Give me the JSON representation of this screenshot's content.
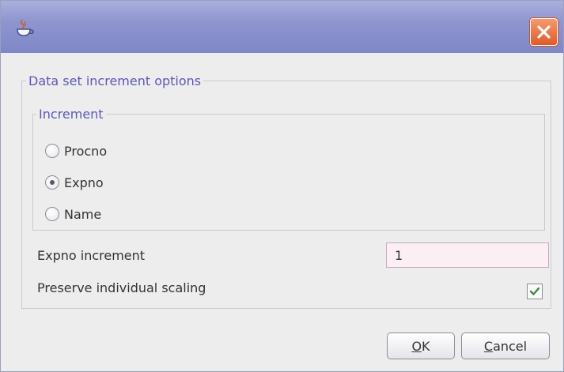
{
  "window": {
    "title": "",
    "close_icon": "close-icon",
    "app_icon": "java-cup-icon"
  },
  "options_group": {
    "legend": "Data set increment options"
  },
  "increment_group": {
    "legend": "Increment",
    "options": [
      {
        "label": "Procno",
        "selected": false
      },
      {
        "label": "Expno",
        "selected": true
      },
      {
        "label": "Name",
        "selected": false
      }
    ]
  },
  "expno_increment": {
    "label": "Expno increment",
    "value": "1"
  },
  "preserve_scaling": {
    "label": "Preserve individual scaling",
    "checked": true
  },
  "buttons": {
    "ok": "OK",
    "cancel": "Cancel"
  },
  "colors": {
    "titlebar": "#8e95cf",
    "legend_text": "#5c57b8",
    "close_button": "#e05a2a"
  }
}
